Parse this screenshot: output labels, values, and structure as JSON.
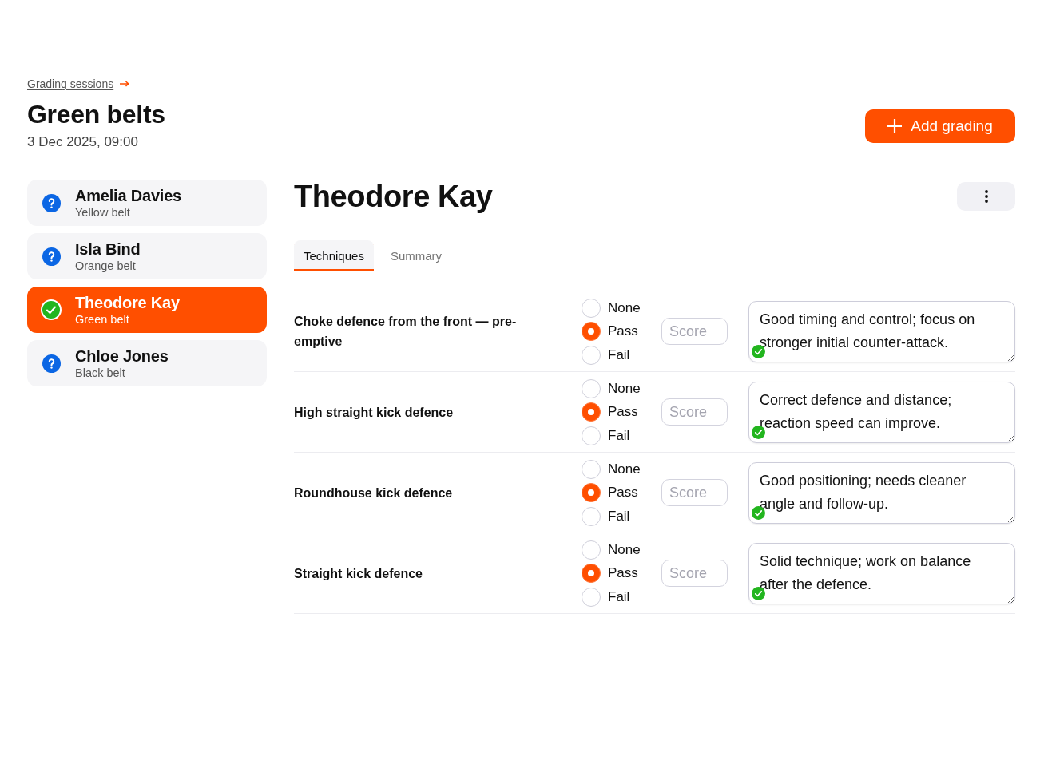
{
  "breadcrumb": {
    "label": "Grading sessions"
  },
  "session": {
    "title": "Green belts",
    "datetime": "3 Dec 2025, 09:00"
  },
  "add_button": {
    "label": "Add grading"
  },
  "students": [
    {
      "name": "Amelia Davies",
      "belt": "Yellow belt",
      "graded": false,
      "selected": false
    },
    {
      "name": "Isla Bind",
      "belt": "Orange belt",
      "graded": false,
      "selected": false
    },
    {
      "name": "Theodore Kay",
      "belt": "Green belt",
      "graded": true,
      "selected": true
    },
    {
      "name": "Chloe Jones",
      "belt": "Black belt",
      "graded": false,
      "selected": false
    }
  ],
  "student": {
    "name": "Theodore Kay"
  },
  "tabs": [
    {
      "label": "Techniques",
      "selected": true
    },
    {
      "label": "Summary",
      "selected": false
    }
  ],
  "techniques": [
    {
      "name": "Choke defence from the front — pre-emptive",
      "options": [
        {
          "label": "None",
          "selected": false
        },
        {
          "label": "Pass",
          "selected": true
        },
        {
          "label": "Fail",
          "selected": false
        }
      ],
      "score": {
        "placeholder": "Score"
      },
      "comment": "Good timing and control; focus on stronger initial counter-attack.",
      "saved": true
    },
    {
      "name": "High straight kick defence",
      "options": [
        {
          "label": "None",
          "selected": false
        },
        {
          "label": "Pass",
          "selected": true
        },
        {
          "label": "Fail",
          "selected": false
        }
      ],
      "score": {
        "placeholder": "Score"
      },
      "comment": "Correct defence and distance; reaction speed can improve.",
      "saved": true
    },
    {
      "name": "Roundhouse kick defence",
      "options": [
        {
          "label": "None",
          "selected": false
        },
        {
          "label": "Pass",
          "selected": true
        },
        {
          "label": "Fail",
          "selected": false
        }
      ],
      "score": {
        "placeholder": "Score"
      },
      "comment": "Good positioning; needs cleaner angle and follow-up.",
      "saved": true
    },
    {
      "name": "Straight kick defence",
      "options": [
        {
          "label": "None",
          "selected": false
        },
        {
          "label": "Pass",
          "selected": true
        },
        {
          "label": "Fail",
          "selected": false
        }
      ],
      "score": {
        "placeholder": "Score"
      },
      "comment": "Solid technique; work on balance after the defence.",
      "saved": true
    }
  ]
}
